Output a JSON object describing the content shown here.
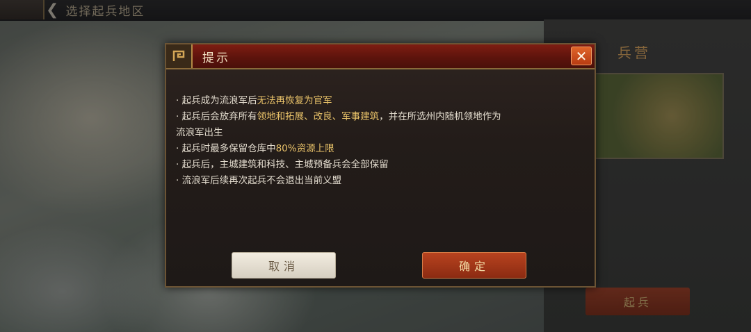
{
  "background": {
    "top_title": "选择起兵地区",
    "panel_title": "兵营",
    "panel_text": "",
    "panel_button": "起兵"
  },
  "dialog": {
    "title": "提示",
    "lines": [
      [
        {
          "t": "· 起兵成为流浪军后",
          "h": false
        },
        {
          "t": "无法再恢复为官军",
          "h": true
        }
      ],
      [
        {
          "t": "· 起兵后会放弃所有",
          "h": false
        },
        {
          "t": "领地和拓展、改良、军事建筑",
          "h": true
        },
        {
          "t": "，并在所选州内随机领地作为",
          "h": false
        }
      ],
      [
        {
          "t": "流浪军出生",
          "h": false
        }
      ],
      [
        {
          "t": "· 起兵时最多保留仓库中",
          "h": false
        },
        {
          "t": "80%资源上限",
          "h": true
        }
      ],
      [
        {
          "t": "· 起兵后，主城建筑和科技、主城预备兵会全部保留",
          "h": false
        }
      ],
      [
        {
          "t": "· 流浪军后续再次起兵不会退出当前义盟",
          "h": false
        }
      ]
    ],
    "cancel_label": "取消",
    "confirm_label": "确定"
  },
  "colors": {
    "header_red": "#7e1d12",
    "highlight_gold": "#ebc46a",
    "confirm_orange": "#b8431f"
  }
}
